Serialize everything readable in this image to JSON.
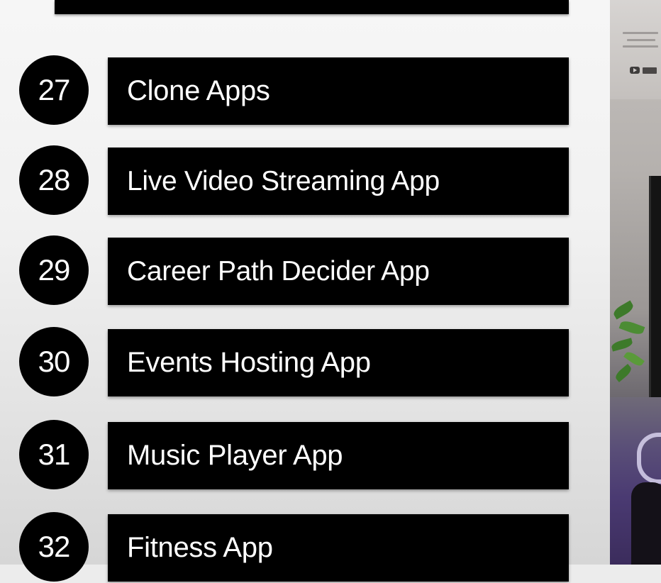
{
  "items": [
    {
      "number": "27",
      "label": "Clone Apps"
    },
    {
      "number": "28",
      "label": "Live Video Streaming App"
    },
    {
      "number": "29",
      "label": "Career Path Decider App"
    },
    {
      "number": "30",
      "label": "Events Hosting App"
    },
    {
      "number": "31",
      "label": "Music Player App"
    },
    {
      "number": "32",
      "label": "Fitness App"
    }
  ],
  "colors": {
    "bar": "#000000",
    "text": "#ffffff",
    "background": "#f1f1f1"
  },
  "icons": [
    "youtube-icon"
  ]
}
